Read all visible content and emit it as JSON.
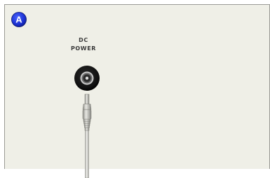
{
  "badge": {
    "letter": "A",
    "color": "#1a2fd0"
  },
  "port": {
    "line1": "DC",
    "line2": "POWER"
  },
  "icons": {
    "badge": "letter-a-badge-icon",
    "jack": "dc-power-jack-icon",
    "cable": "power-cable-plug-icon"
  }
}
